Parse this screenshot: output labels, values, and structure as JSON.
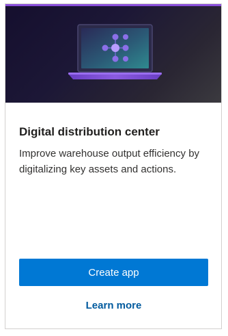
{
  "card": {
    "title": "Digital distribution center",
    "description": "Improve warehouse output efficiency by digitalizing key assets and actions.",
    "primary_button_label": "Create app",
    "link_label": "Learn more"
  },
  "hero": {
    "illustration_icon": "laptop-network-icon"
  },
  "colors": {
    "accent_purple": "#8a4fdb",
    "primary_blue": "#0078d4",
    "link_blue": "#005a9e",
    "hero_background": "#1c1736"
  }
}
